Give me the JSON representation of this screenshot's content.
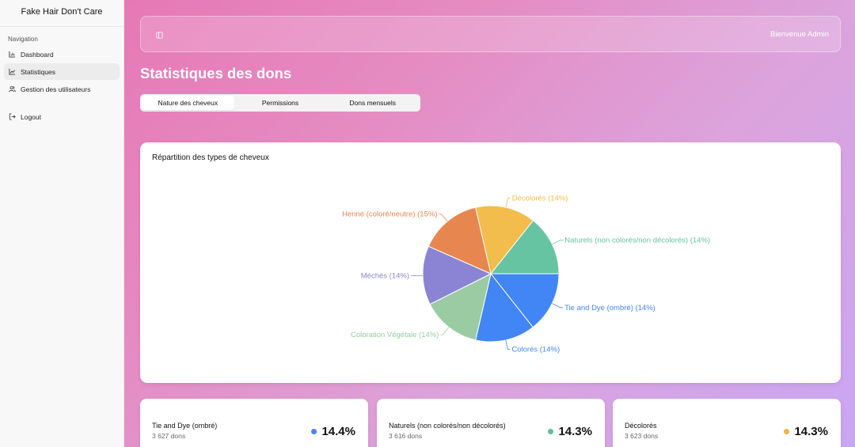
{
  "app": {
    "title": "Fake Hair Don't Care"
  },
  "sidebar": {
    "heading": "Navigation",
    "items": [
      {
        "label": "Dashboard",
        "icon": "bar-chart-icon"
      },
      {
        "label": "Statistiques",
        "icon": "line-chart-icon",
        "active": true
      },
      {
        "label": "Gestion des utilisateurs",
        "icon": "users-icon"
      }
    ],
    "logout": {
      "label": "Logout",
      "icon": "logout-icon"
    }
  },
  "header": {
    "welcome": "Bienvenue Admin",
    "toggle_icon": "sidebar-toggle-icon"
  },
  "page": {
    "title": "Statistiques des dons"
  },
  "tabs": [
    {
      "label": "Nature des cheveux",
      "active": true
    },
    {
      "label": "Permissions"
    },
    {
      "label": "Dons mensuels"
    }
  ],
  "chart_data": {
    "type": "pie",
    "title": "Répartition des types de cheveux",
    "slices": [
      {
        "label": "Tie and Dye (ombré) (14%)",
        "value": 14.4,
        "color": "#4285f4"
      },
      {
        "label": "Colorés (14%)",
        "value": 14.2,
        "color": "#4285f4"
      },
      {
        "label": "Coloration Végétale (14%)",
        "value": 14.0,
        "color": "#9bcba3"
      },
      {
        "label": "Méchés (14%)",
        "value": 14.0,
        "color": "#8b84d4"
      },
      {
        "label": "Henné (coloré/neutre) (15%)",
        "value": 14.8,
        "color": "#e8864f"
      },
      {
        "label": "Décolorés (14%)",
        "value": 14.3,
        "color": "#f2bd4c"
      },
      {
        "label": "Naturels (non colorés/non décolorés) (14%)",
        "value": 14.3,
        "color": "#66c4a2"
      }
    ]
  },
  "stats": [
    {
      "name": "Tie and Dye (ombré)",
      "count": "3 627 dons",
      "pct": "14.4%",
      "color": "#4285f4"
    },
    {
      "name": "Naturels (non colorés/non décolorés)",
      "count": "3 616 dons",
      "pct": "14.3%",
      "color": "#5cbf9c"
    },
    {
      "name": "Décolorés",
      "count": "3 623 dons",
      "pct": "14.3%",
      "color": "#f2b440"
    }
  ]
}
